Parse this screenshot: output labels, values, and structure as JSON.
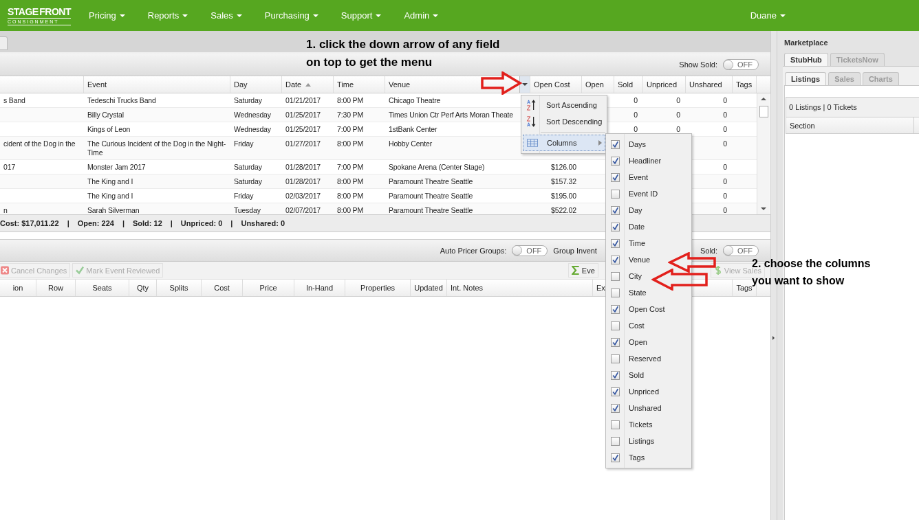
{
  "nav": {
    "logo": {
      "line_1": "STAGE",
      "line_2": "FRONT",
      "tagline": "CONSIGNMENT"
    },
    "menus": [
      "Pricing",
      "Reports",
      "Sales",
      "Purchasing",
      "Support",
      "Admin"
    ],
    "user": "Duane"
  },
  "annotations": [
    {
      "lines": [
        "1. click the down arrow of any field",
        "on top to get the menu"
      ]
    },
    {
      "lines": [
        "2. choose the columns",
        "you want to show"
      ]
    }
  ],
  "events_grid": {
    "show_sold": {
      "label": "Show Sold:",
      "on": false,
      "state_text": "OFF"
    },
    "columns": [
      {
        "sorted": false,
        "menu_open": false
      },
      {
        "label": "Event",
        "sorted": false,
        "menu_open": false
      },
      {
        "label": "Day",
        "sorted": false,
        "menu_open": false
      },
      {
        "label": "Date",
        "sorted": true,
        "menu_open": false
      },
      {
        "label": "Time",
        "sorted": false,
        "menu_open": false
      },
      {
        "label": "Venue",
        "sorted": false,
        "menu_open": true
      },
      {
        "label": "Open Cost",
        "sorted": false,
        "menu_open": false
      },
      {
        "label": "Open",
        "sorted": false,
        "menu_open": false
      },
      {
        "label": "Sold",
        "sorted": false,
        "menu_open": false
      },
      {
        "label": "Unpriced",
        "sorted": false,
        "menu_open": false
      },
      {
        "label": "Unshared",
        "sorted": false,
        "menu_open": false
      },
      {
        "label": "Tags",
        "sorted": false,
        "menu_open": false
      }
    ],
    "rows": [
      {
        "cells": [
          "s Band",
          "Tedeschi Trucks Band",
          "Saturday",
          "01/21/2017",
          "8:00 PM",
          "Chicago Theatre",
          null,
          null,
          "0",
          "0",
          "0",
          null
        ]
      },
      {
        "cells": [
          null,
          "Billy Crystal",
          "Wednesday",
          "01/25/2017",
          "7:30 PM",
          "Times Union Ctr Perf Arts Moran Theate",
          null,
          null,
          "0",
          "0",
          "0",
          null
        ]
      },
      {
        "cells": [
          null,
          "Kings of Leon",
          "Wednesday",
          "01/25/2017",
          "7:00 PM",
          "1stBank Center",
          null,
          null,
          "0",
          "0",
          "0",
          null
        ]
      },
      {
        "cells": [
          "cident of the Dog in the",
          "The Curious Incident of the Dog in the Night-Time",
          "Friday",
          "01/27/2017",
          "8:00 PM",
          "Hobby Center",
          null,
          null,
          null,
          null,
          "0",
          null
        ]
      },
      {
        "cells": [
          "017",
          "Monster Jam 2017",
          "Saturday",
          "01/28/2017",
          "7:00 PM",
          "Spokane Arena (Center Stage)",
          "$126.00",
          null,
          null,
          null,
          "0",
          null
        ]
      },
      {
        "cells": [
          null,
          "The King and I",
          "Saturday",
          "01/28/2017",
          "8:00 PM",
          "Paramount Theatre Seattle",
          "$157.32",
          null,
          null,
          null,
          "0",
          null
        ]
      },
      {
        "cells": [
          null,
          "The King and I",
          "Friday",
          "02/03/2017",
          "8:00 PM",
          "Paramount Theatre Seattle",
          "$195.00",
          null,
          null,
          null,
          "0",
          null
        ]
      },
      {
        "cells": [
          "n",
          "Sarah Silverman",
          "Tuesday",
          "02/07/2017",
          "8:00 PM",
          "Paramount Theatre Seattle",
          "$522.02",
          null,
          null,
          null,
          "0",
          null
        ]
      }
    ],
    "summary": {
      "separator": "|",
      "items": [
        "Cost: $17,011.22",
        "Open: 224",
        "Sold: 12",
        "Unpriced: 0",
        "Unshared: 0"
      ]
    }
  },
  "inventory": {
    "toggles": [
      {
        "label": "Auto Pricer Groups:",
        "on": false,
        "state_text": "OFF"
      },
      {
        "label": "Group Invent"
      },
      {
        "label": "Sold:",
        "on": false,
        "state_text": "OFF"
      }
    ],
    "toolbar": [
      {
        "kind": "cancel",
        "label": "Cancel Changes",
        "disabled": true
      },
      {
        "kind": "review",
        "label": "Mark Event Reviewed",
        "disabled": true
      },
      {
        "kind": "sum",
        "label": "Eve",
        "disabled": false
      },
      {
        "kind": "dollar",
        "label": "View Sales",
        "disabled": true
      }
    ],
    "columns": [
      "ion",
      "Row",
      "Seats",
      "Qty",
      "Splits",
      "Cost",
      "Price",
      "In-Hand",
      "Properties",
      "Updated",
      "Int. Notes",
      "Ex",
      "Tags"
    ]
  },
  "column_menu": {
    "items": [
      {
        "kind": "sort",
        "label": "Sort Ascending",
        "selected": false
      },
      {
        "kind": "sort",
        "label": "Sort Descending",
        "selected": false
      },
      {
        "kind": "submenu",
        "label": "Columns",
        "selected": true
      }
    ],
    "columns": [
      {
        "label": "Days",
        "checked": true
      },
      {
        "label": "Headliner",
        "checked": true
      },
      {
        "label": "Event",
        "checked": true
      },
      {
        "label": "Event ID",
        "checked": false
      },
      {
        "label": "Day",
        "checked": true
      },
      {
        "label": "Date",
        "checked": true
      },
      {
        "label": "Time",
        "checked": true
      },
      {
        "label": "Venue",
        "checked": true
      },
      {
        "label": "City",
        "checked": false
      },
      {
        "label": "State",
        "checked": false
      },
      {
        "label": "Open Cost",
        "checked": true
      },
      {
        "label": "Cost",
        "checked": false
      },
      {
        "label": "Open",
        "checked": true
      },
      {
        "label": "Reserved",
        "checked": false
      },
      {
        "label": "Sold",
        "checked": true
      },
      {
        "label": "Unpriced",
        "checked": true
      },
      {
        "label": "Unshared",
        "checked": true
      },
      {
        "label": "Tickets",
        "checked": false
      },
      {
        "label": "Listings",
        "checked": false
      },
      {
        "label": "Tags",
        "checked": true
      }
    ]
  },
  "marketplace": {
    "title": "Marketplace",
    "tabs": [
      {
        "label": "StubHub",
        "selected": true
      },
      {
        "label": "TicketsNow",
        "selected": false
      }
    ],
    "subtabs": [
      {
        "label": "Listings",
        "selected": true
      },
      {
        "label": "Sales",
        "selected": false
      },
      {
        "label": "Charts",
        "selected": false
      }
    ],
    "summary": "0 Listings | 0 Tickets",
    "columns": [
      "Section"
    ]
  }
}
